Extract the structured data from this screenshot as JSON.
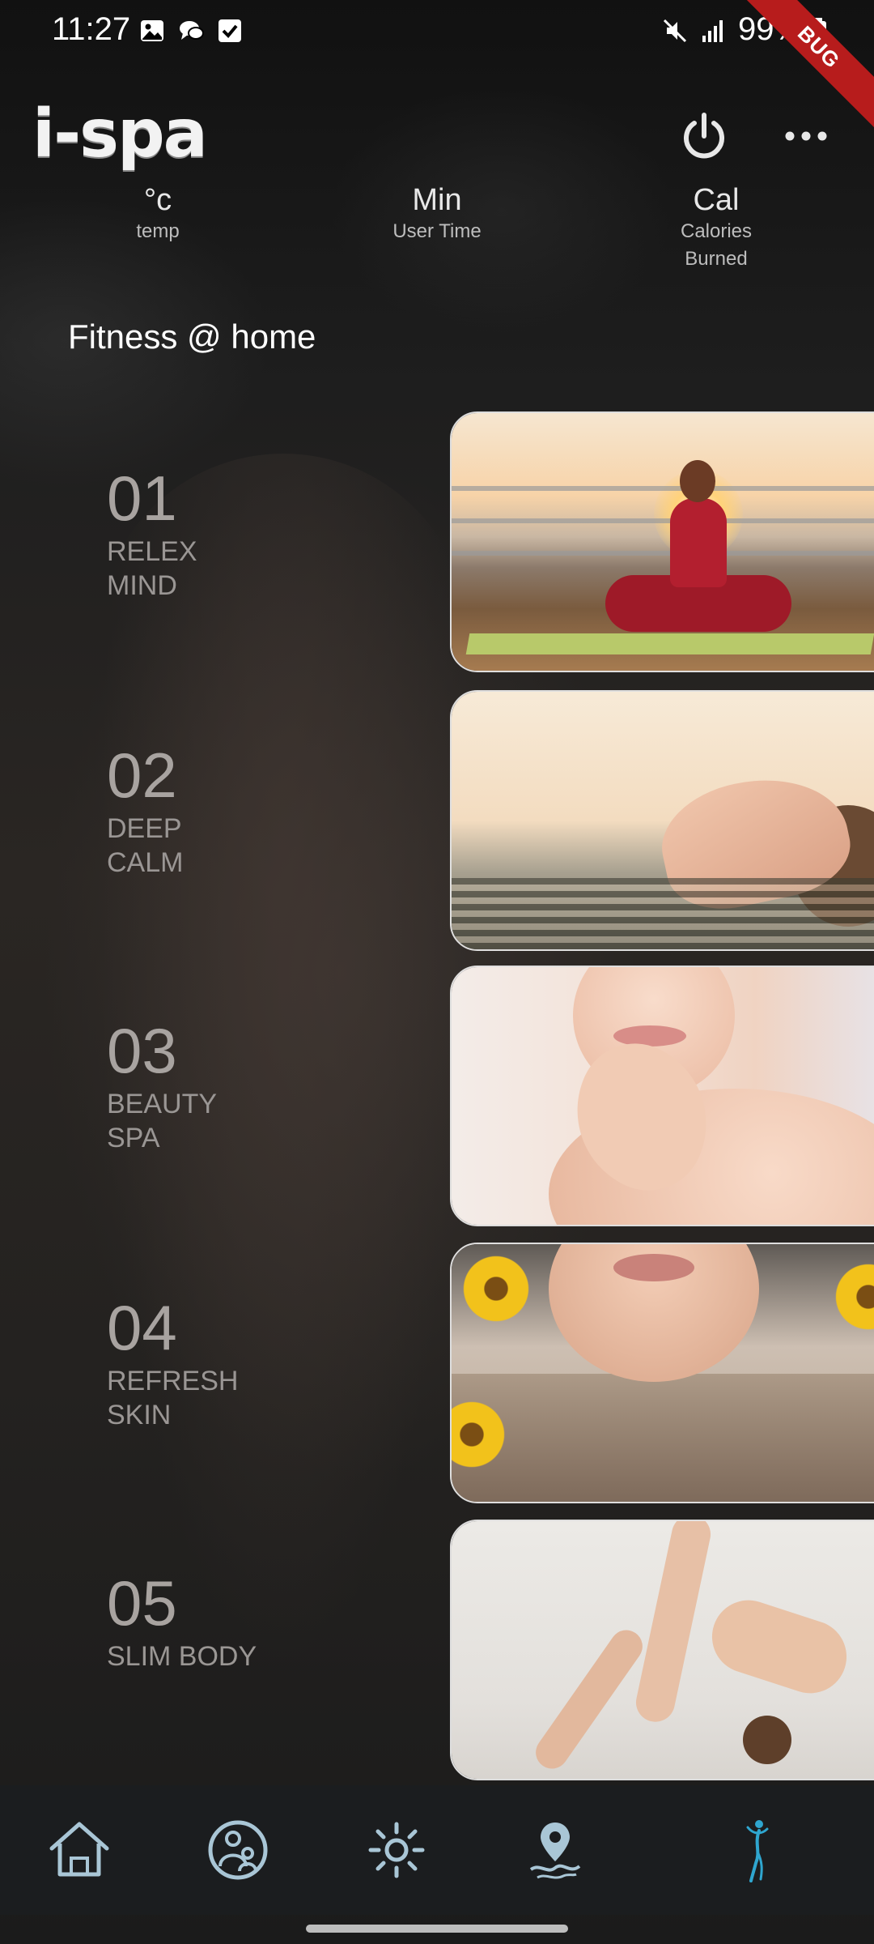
{
  "status_bar": {
    "time": "11:27",
    "battery": "99%",
    "debug_badge": "BUG",
    "icons": [
      "gallery-icon",
      "chat-bubbles-icon",
      "checkbox-icon",
      "mute-icon",
      "signal-icon",
      "battery-icon"
    ]
  },
  "header": {
    "logo_text": "i-spa",
    "power_icon": "power-icon",
    "more_icon": "more-horizontal-icon"
  },
  "stats": {
    "temp": {
      "value": "°c",
      "label": "temp"
    },
    "time": {
      "value": "Min",
      "label": "User Time"
    },
    "calories": {
      "value": "Cal",
      "label_line1": "Calories",
      "label_line2": "Burned"
    }
  },
  "section_title": "Fitness @ home",
  "items": [
    {
      "number": "01",
      "line1": "RELEX",
      "line2": "MIND"
    },
    {
      "number": "02",
      "line1": "DEEP",
      "line2": "CALM"
    },
    {
      "number": "03",
      "line1": "BEAUTY",
      "line2": "SPA"
    },
    {
      "number": "04",
      "line1": "REFRESH",
      "line2": "SKIN"
    },
    {
      "number": "05",
      "line1": "SLIM BODY",
      "line2": ""
    }
  ],
  "bottom_nav": [
    {
      "icon": "home-icon"
    },
    {
      "icon": "family-icon"
    },
    {
      "icon": "sun-icon"
    },
    {
      "icon": "location-water-icon"
    },
    {
      "icon": "body-figure-icon"
    }
  ],
  "colors": {
    "nav_icon": "#a9c6d6",
    "nav_active": "#2fa6cf",
    "nav_bg": "#1b1d1f",
    "debug_ribbon": "#b71c1c"
  }
}
